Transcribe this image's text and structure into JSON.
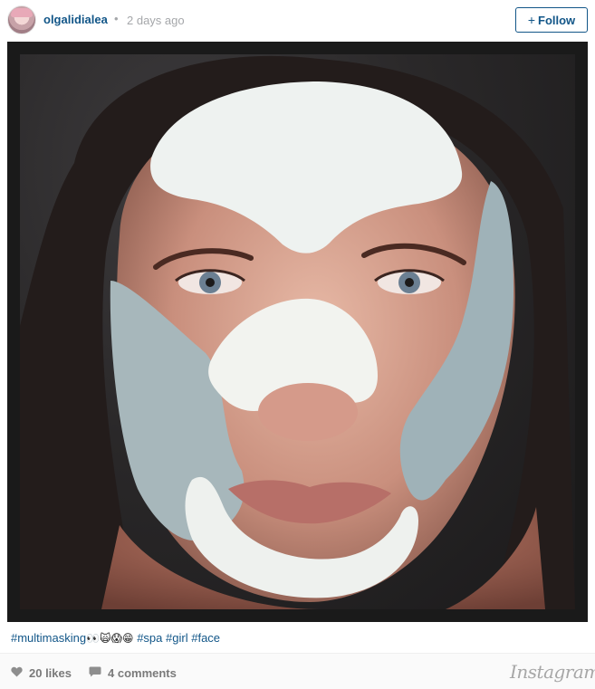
{
  "post": {
    "username": "olgalidialea",
    "separator": "•",
    "timestamp": "2 days ago",
    "follow_label": "Follow",
    "follow_icon": "plus-icon"
  },
  "photo": {
    "alt": "selfie with face masks"
  },
  "caption": {
    "tag_multimasking": "#multimasking",
    "emoji": "👀🙀😱😁",
    "tag_spa": "#spa",
    "tag_girl": "#girl",
    "tag_face": "#face"
  },
  "footer": {
    "likes": "20 likes",
    "comments": "4 comments",
    "brand": "Instagram"
  },
  "colors": {
    "link": "#125688",
    "muted": "#a5a7aa"
  }
}
